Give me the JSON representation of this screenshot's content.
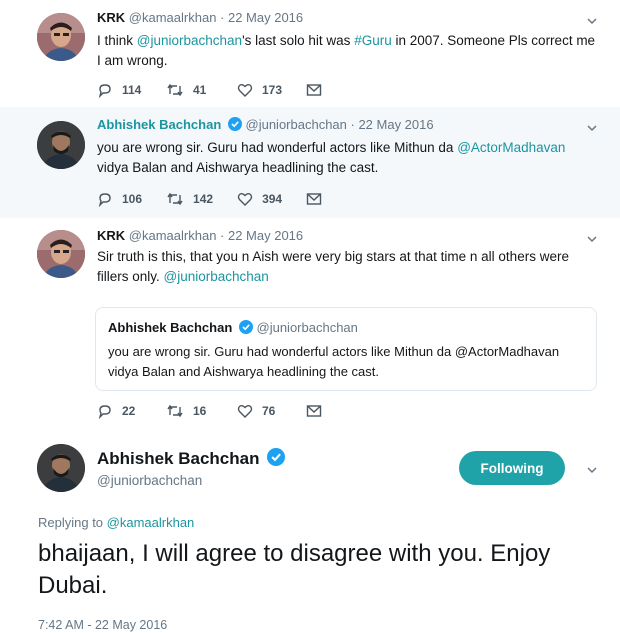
{
  "colors": {
    "accent": "#1b95a0",
    "button": "#1fa3a8",
    "thread_line": "#aab8c2",
    "muted": "#657786"
  },
  "tweets": [
    {
      "name": "KRK",
      "handle_date": "@kamaalrkhan · 22 May 2016",
      "text_parts": [
        "I think ",
        "@juniorbachchan",
        "'s last solo hit was ",
        "#Guru",
        " in 2007. Someone Pls correct me I am wrong."
      ],
      "replies": "114",
      "retweets": "41",
      "likes": "173",
      "avatar_icon": "krk-avatar"
    },
    {
      "name": "Abhishek Bachchan",
      "handle_date": "@juniorbachchan · 22 May 2016",
      "text_parts": [
        "you are wrong sir. Guru had wonderful actors like Mithun da ",
        "@ActorMadhavan",
        " vidya Balan and Aishwarya headlining the cast."
      ],
      "replies": "106",
      "retweets": "142",
      "likes": "394",
      "avatar_icon": "abhishek-avatar"
    },
    {
      "name": "KRK",
      "handle_date": "@kamaalrkhan · 22 May 2016",
      "text_parts": [
        "Sir truth is this, that you n Aish were very big stars at that time n all others were fillers only. ",
        "@juniorbachchan"
      ],
      "quote": {
        "name": "Abhishek Bachchan",
        "handle": "@juniorbachchan",
        "text": "you are wrong sir. Guru had wonderful actors like Mithun da @ActorMadhavan vidya Balan and Aishwarya headlining the cast."
      },
      "replies": "22",
      "retweets": "16",
      "likes": "76",
      "avatar_icon": "krk-avatar"
    }
  ],
  "main": {
    "name": "Abhishek Bachchan",
    "handle": "@juniorbachchan",
    "follow_label": "Following",
    "replying_prefix": "Replying to ",
    "replying_handle": "@kamaalrkhan",
    "text": "bhaijaan, I will agree to disagree with you. Enjoy Dubai.",
    "timestamp": "7:42 AM - 22 May 2016"
  }
}
